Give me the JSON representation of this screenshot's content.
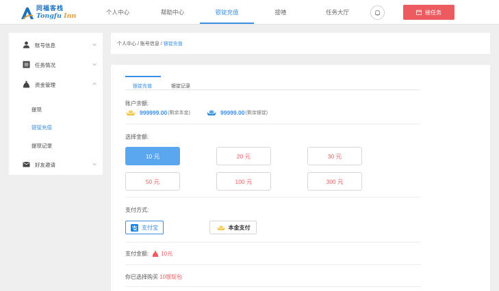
{
  "logo": {
    "cn": "同福客栈",
    "en_a": "Tongfu ",
    "en_b": "Inn"
  },
  "nav": {
    "items": [
      "个人中心",
      "帮助中心",
      "银锭充值",
      "接喳",
      "任务大厅"
    ],
    "active_index": 2
  },
  "header": {
    "task_button": "接任务"
  },
  "sidebar": {
    "items": [
      {
        "label": "账号信息",
        "icon": "user-icon"
      },
      {
        "label": "任务情况",
        "icon": "list-icon"
      },
      {
        "label": "资金管理",
        "icon": "money-bag-icon"
      },
      {
        "label": "好友邀请",
        "icon": "mail-icon"
      }
    ],
    "sub_items": [
      "提现",
      "银锭充值",
      "提现记录"
    ],
    "active_sub_index": 1
  },
  "breadcrumb": {
    "prefix": "个人中心 / 账号信息 / ",
    "current": "银锭充值"
  },
  "tabs": [
    "银锭充值",
    "银锭记录"
  ],
  "balance": {
    "label": "账户余额:",
    "principal_amount": "999999.00",
    "principal_note": "(剩余本金)",
    "ingot_amount": "99999.00",
    "ingot_note": "(剩余银锭)"
  },
  "amount_select": {
    "label": "选择金额:",
    "options": [
      "10 元",
      "20 元",
      "30 元",
      "50 元",
      "100 元",
      "300 元"
    ],
    "selected_index": 0
  },
  "payment": {
    "label": "支付方式:",
    "alipay": "支付宝",
    "balance_pay": "本金支付"
  },
  "pay_amount": {
    "label": "支付金额:",
    "value": "10元"
  },
  "chosen": {
    "prefix": "你已选择购买 ",
    "value": "10银锭包"
  },
  "colors": {
    "accent": "#3a8ee6",
    "danger": "#ec5b5f",
    "selected_fill": "#5aa7ef",
    "gold": "#f3c23c"
  }
}
